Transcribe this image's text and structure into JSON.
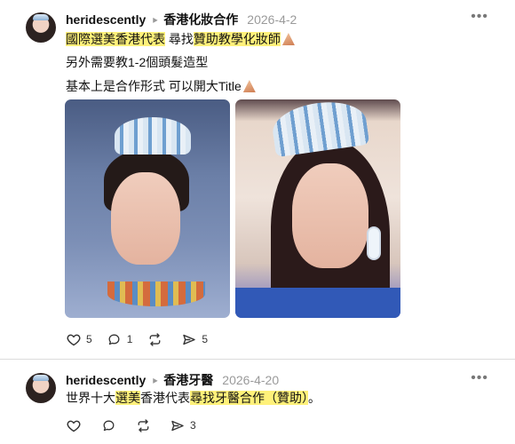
{
  "posts": [
    {
      "username": "heridescently",
      "community": "香港化妝合作",
      "time": "2026-4-2",
      "line1": {
        "prefix_highlight": "國際選美香港代表",
        "middle": " 尋找",
        "suffix_highlight": "贊助教學化妝師"
      },
      "line2": "另外需要教1-2個頭髮造型",
      "line3": "基本上是合作形式 可以開大Title",
      "actions": {
        "likes": "5",
        "comments": "1",
        "reposts": "",
        "shares": "5"
      }
    },
    {
      "username": "heridescently",
      "community": "香港牙醫",
      "time": "2026-4-20",
      "line1": {
        "part1": "世界十大",
        "highlight1": "選美",
        "part2": "香港代表",
        "highlight2": "尋找牙醫合作（贊助）",
        "part3": "。"
      },
      "actions": {
        "likes": "",
        "comments": "",
        "reposts": "",
        "shares": "3"
      }
    }
  ],
  "icons": [
    "avatar",
    "chevron-right-icon",
    "more-icon",
    "heart-icon",
    "comment-icon",
    "repost-icon",
    "share-icon"
  ]
}
